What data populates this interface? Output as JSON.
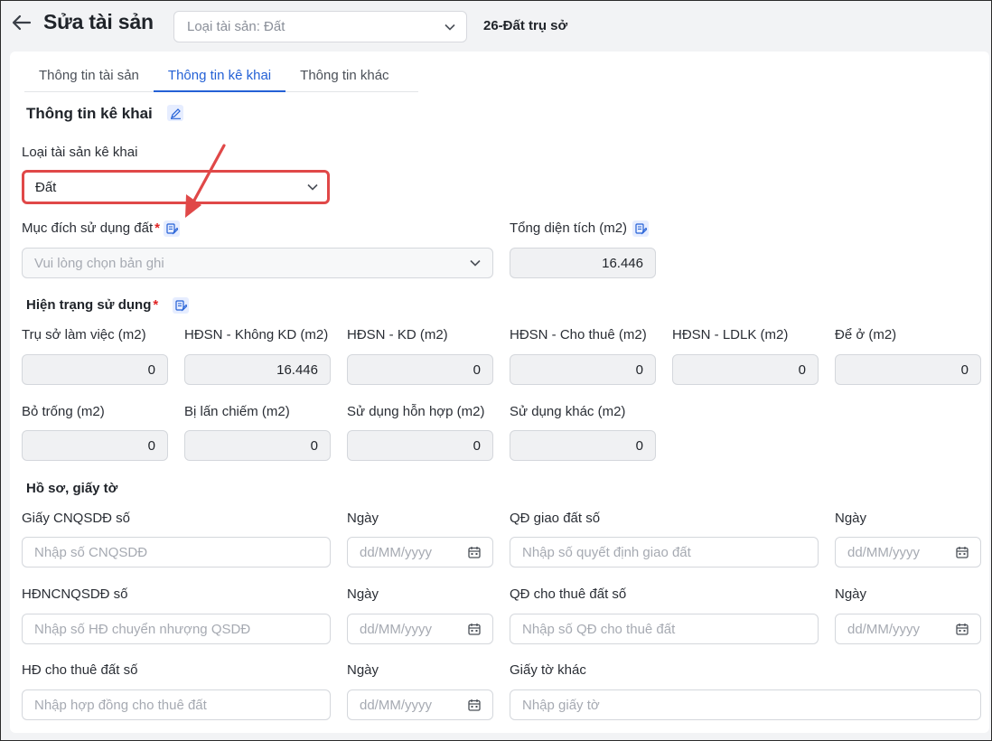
{
  "header": {
    "title": "Sửa tài sản",
    "asset_type_select": "Loại tài sản: Đất",
    "asset_code": "26-Đất trụ sở"
  },
  "tabs": [
    {
      "label": "Thông tin tài sản",
      "active": false
    },
    {
      "label": "Thông tin kê khai",
      "active": true
    },
    {
      "label": "Thông tin khác",
      "active": false
    }
  ],
  "declaration": {
    "section_title": "Thông tin kê khai",
    "asset_type_label": "Loại tài sản kê khai",
    "asset_type_value": "Đất",
    "land_purpose_label": "Mục đích sử dụng đất",
    "land_purpose_placeholder": "Vui lòng chọn bản ghi",
    "total_area_label": "Tổng diện tích (m2)",
    "total_area_value": "16.446"
  },
  "usage_status": {
    "title": "Hiện trạng sử dụng",
    "fields": [
      {
        "label": "Trụ sở làm việc (m2)",
        "value": "0"
      },
      {
        "label": "HĐSN - Không KD (m2)",
        "value": "16.446"
      },
      {
        "label": "HĐSN - KD (m2)",
        "value": "0"
      },
      {
        "label": "HĐSN - Cho thuê (m2)",
        "value": "0"
      },
      {
        "label": "HĐSN - LDLK (m2)",
        "value": "0"
      },
      {
        "label": "Để ở (m2)",
        "value": "0"
      },
      {
        "label": "Bỏ trống (m2)",
        "value": "0"
      },
      {
        "label": "Bị lấn chiếm (m2)",
        "value": "0"
      },
      {
        "label": "Sử dụng hỗn hợp (m2)",
        "value": "0"
      },
      {
        "label": "Sử dụng khác (m2)",
        "value": "0"
      }
    ]
  },
  "documents": {
    "title": "Hồ sơ, giấy tờ",
    "date_label": "Ngày",
    "date_placeholder": "dd/MM/yyyy",
    "cert_label": "Giấy CNQSDĐ số",
    "cert_placeholder": "Nhập số CNQSDĐ",
    "alloc_label": "QĐ giao đất số",
    "alloc_placeholder": "Nhập số quyết định giao đất",
    "transfer_label": "HĐNCNQSDĐ số",
    "transfer_placeholder": "Nhập số HĐ chuyển nhượng QSDĐ",
    "lease_decision_label": "QĐ cho thuê đất số",
    "lease_decision_placeholder": "Nhập số QĐ cho thuê đất",
    "lease_contract_label": "HĐ cho thuê đất số",
    "lease_contract_placeholder": "Nhập hợp đồng cho thuê đất",
    "other_label": "Giấy tờ khác",
    "other_placeholder": "Nhập giấy tờ"
  },
  "colors": {
    "accent": "#2461d6",
    "highlight": "#e04848",
    "required": "#e02424"
  }
}
